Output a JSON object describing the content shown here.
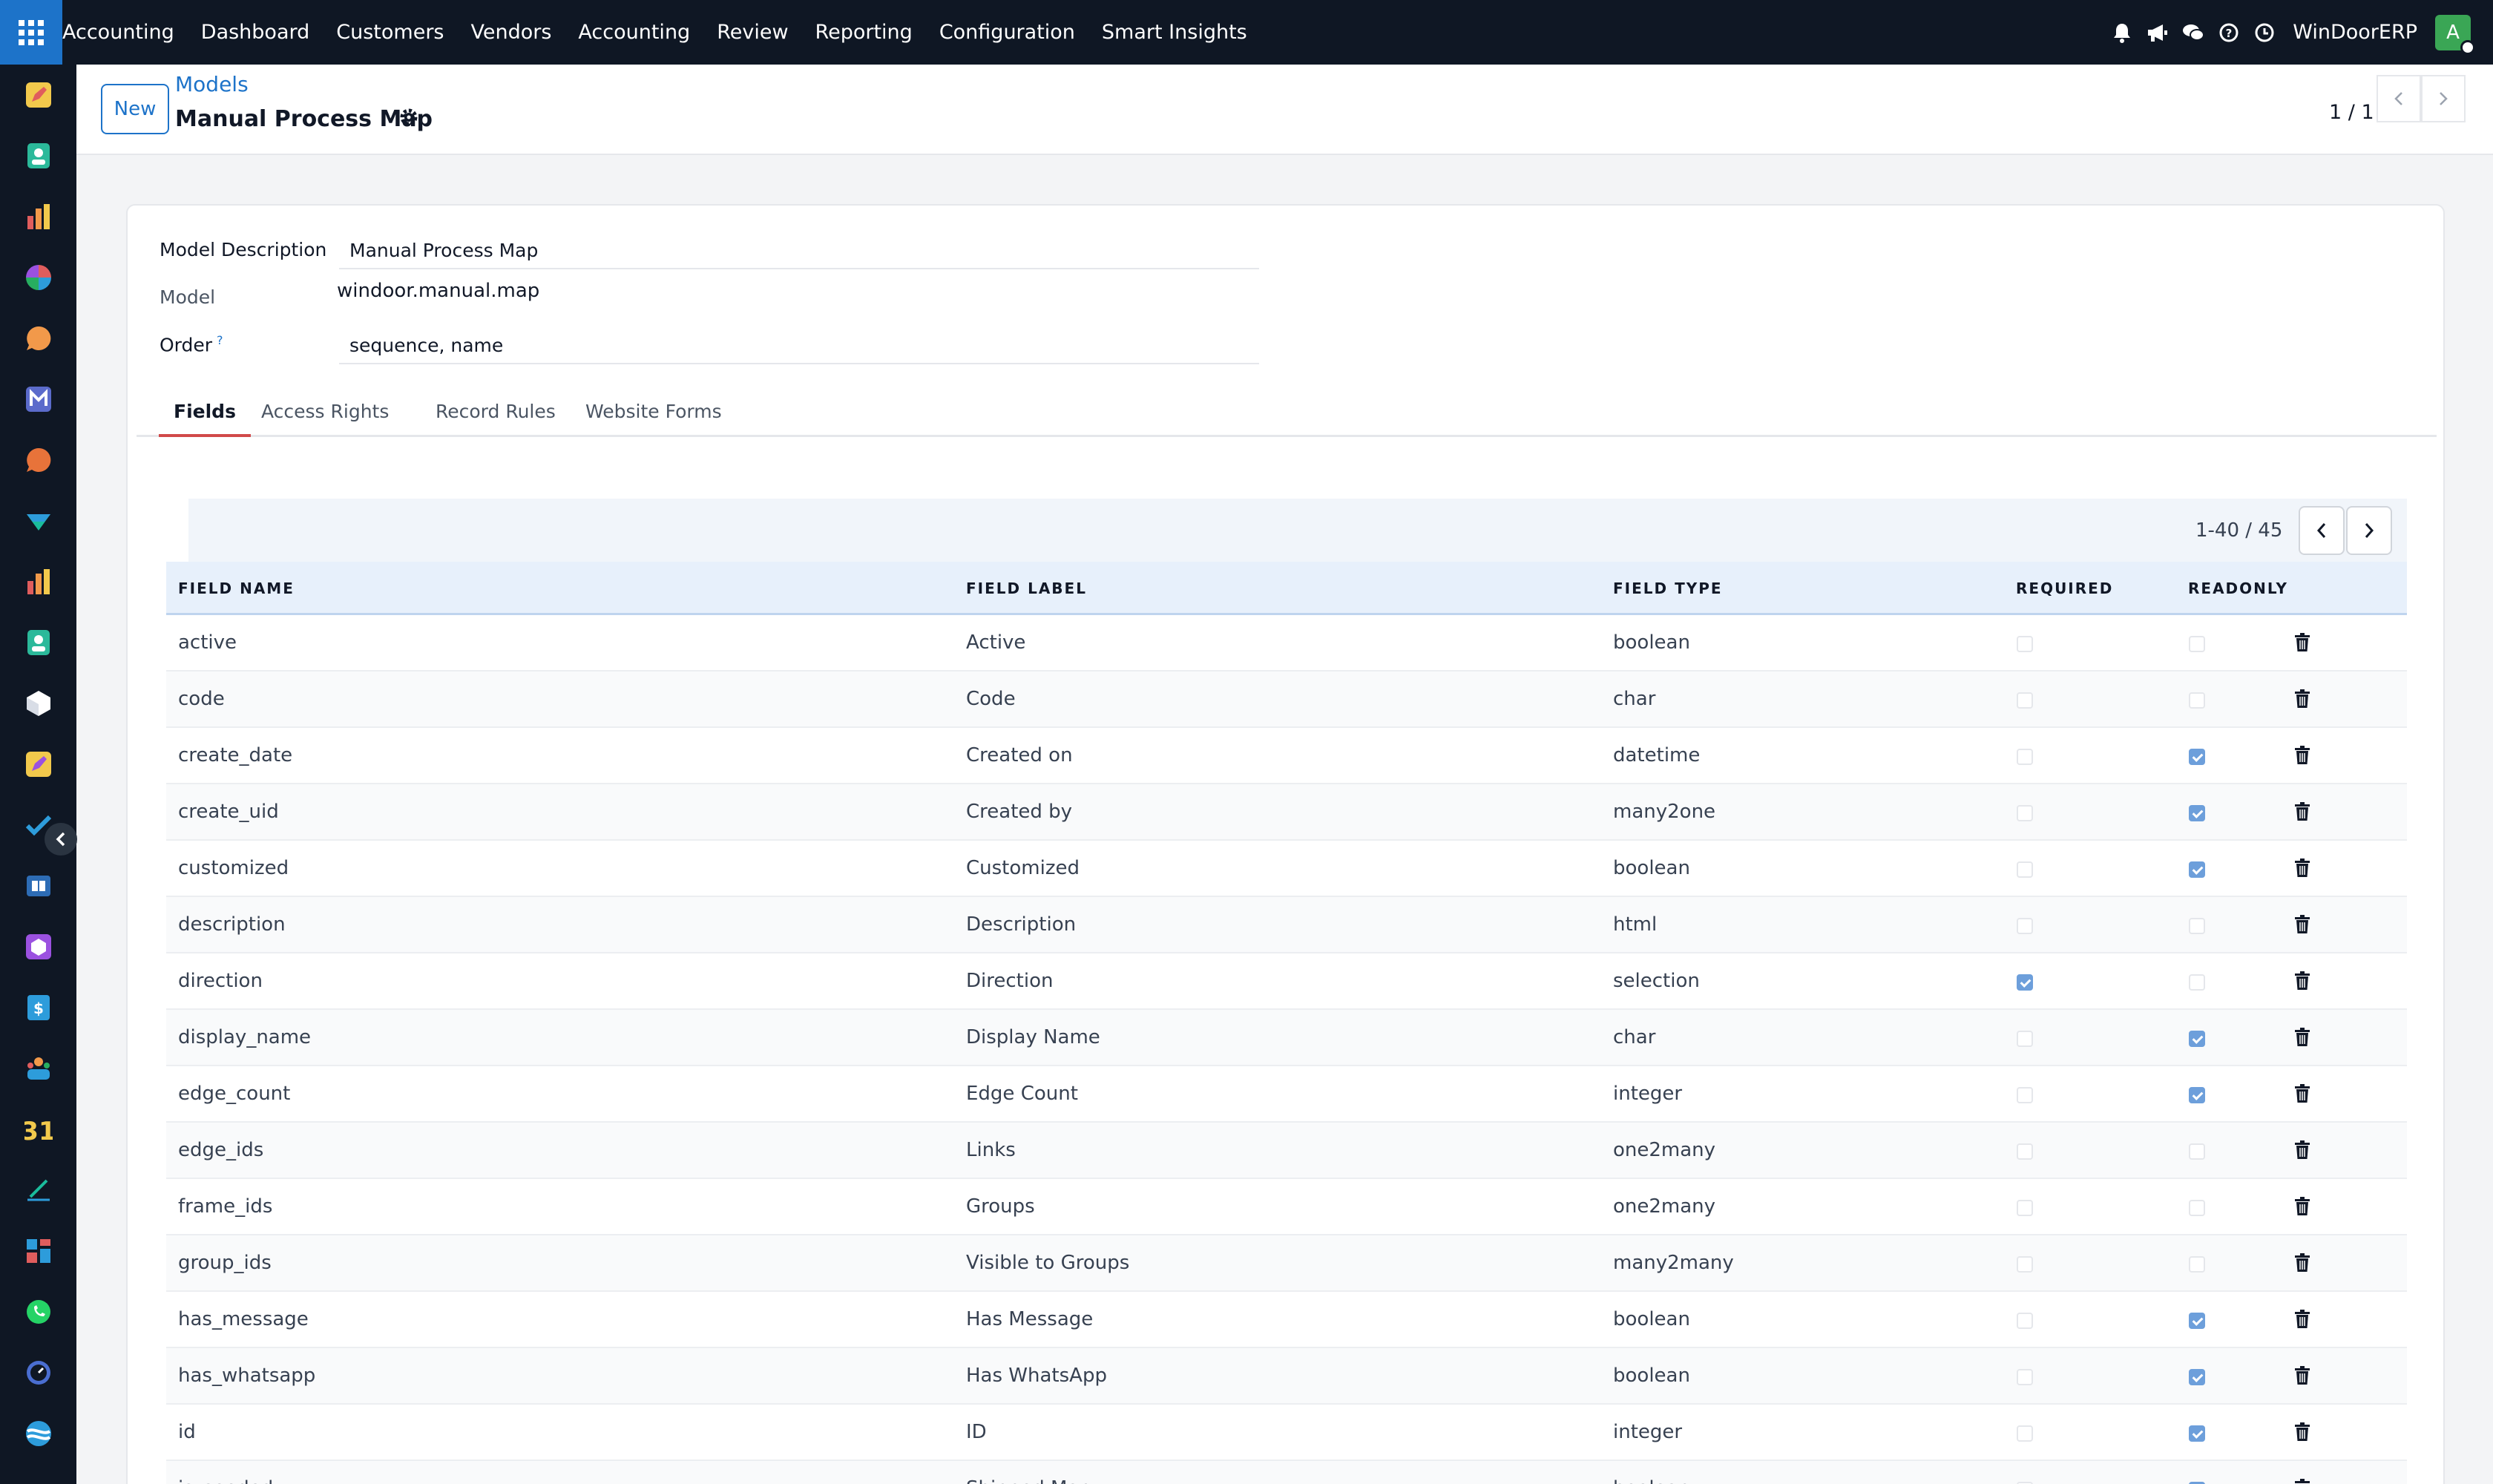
{
  "topbar": {
    "brand": "Accounting",
    "menu": [
      "Dashboard",
      "Customers",
      "Vendors",
      "Accounting",
      "Review",
      "Reporting",
      "Configuration",
      "Smart Insights"
    ],
    "company": "WinDoorERP",
    "avatar_letter": "A"
  },
  "control_panel": {
    "new_label": "New",
    "breadcrumb_parent": "Models",
    "record_title": "Manual Process Map",
    "pager": "1 / 1"
  },
  "form": {
    "description_label": "Model Description",
    "description_value": "Manual Process Map",
    "model_label": "Model",
    "model_value": "windoor.manual.map",
    "order_label": "Order",
    "order_help": "?",
    "order_value": "sequence, name"
  },
  "tabs": [
    "Fields",
    "Access Rights",
    "Record Rules",
    "Website Forms"
  ],
  "list": {
    "pager": "1-40 / 45",
    "columns": [
      "FIELD NAME",
      "FIELD LABEL",
      "FIELD TYPE",
      "REQUIRED",
      "READONLY"
    ],
    "rows": [
      {
        "name": "active",
        "label": "Active",
        "type": "boolean",
        "required": false,
        "readonly": false
      },
      {
        "name": "code",
        "label": "Code",
        "type": "char",
        "required": false,
        "readonly": false
      },
      {
        "name": "create_date",
        "label": "Created on",
        "type": "datetime",
        "required": false,
        "readonly": true
      },
      {
        "name": "create_uid",
        "label": "Created by",
        "type": "many2one",
        "required": false,
        "readonly": true
      },
      {
        "name": "customized",
        "label": "Customized",
        "type": "boolean",
        "required": false,
        "readonly": true
      },
      {
        "name": "description",
        "label": "Description",
        "type": "html",
        "required": false,
        "readonly": false
      },
      {
        "name": "direction",
        "label": "Direction",
        "type": "selection",
        "required": true,
        "readonly": false
      },
      {
        "name": "display_name",
        "label": "Display Name",
        "type": "char",
        "required": false,
        "readonly": true
      },
      {
        "name": "edge_count",
        "label": "Edge Count",
        "type": "integer",
        "required": false,
        "readonly": true
      },
      {
        "name": "edge_ids",
        "label": "Links",
        "type": "one2many",
        "required": false,
        "readonly": false
      },
      {
        "name": "frame_ids",
        "label": "Groups",
        "type": "one2many",
        "required": false,
        "readonly": false
      },
      {
        "name": "group_ids",
        "label": "Visible to Groups",
        "type": "many2many",
        "required": false,
        "readonly": false
      },
      {
        "name": "has_message",
        "label": "Has Message",
        "type": "boolean",
        "required": false,
        "readonly": true
      },
      {
        "name": "has_whatsapp",
        "label": "Has WhatsApp",
        "type": "boolean",
        "required": false,
        "readonly": true
      },
      {
        "name": "id",
        "label": "ID",
        "type": "integer",
        "required": false,
        "readonly": true
      },
      {
        "name": "is_seeded",
        "label": "Shipped Map",
        "type": "boolean",
        "required": false,
        "readonly": true
      }
    ]
  },
  "icons": {
    "sidebar": [
      "pencil-app-icon",
      "contacts-app-icon",
      "bars-app-icon",
      "pie-app-icon",
      "chat-app-icon",
      "mail-app-icon",
      "discuss-app-icon",
      "check-app-icon",
      "reports-app-icon",
      "contacts2-app-icon",
      "box-app-icon",
      "pencil2-app-icon",
      "todo-app-icon",
      "book-app-icon",
      "cube-app-icon",
      "invoice-app-icon",
      "team-app-icon",
      "calendar-app-icon",
      "sign-app-icon",
      "dashboard-app-icon",
      "whatsapp-app-icon",
      "timer-app-icon",
      "swirl-app-icon"
    ]
  },
  "colors": {
    "topbar": "#0f1724",
    "primary": "#1d73c9",
    "active_tab": "#d14a4a",
    "checkbox": "#6d9fdb"
  }
}
